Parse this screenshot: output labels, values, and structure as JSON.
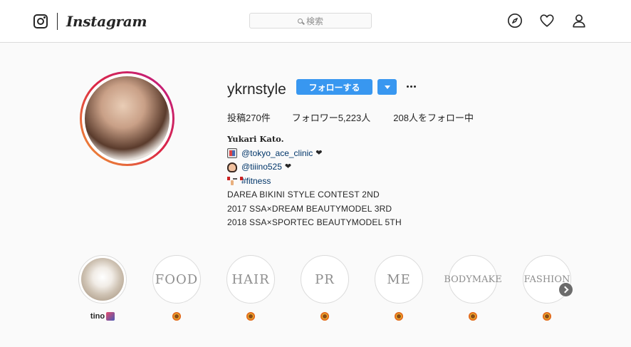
{
  "nav": {
    "logo_text": "Instagram",
    "search_placeholder": "検索",
    "icons": [
      "camera-icon",
      "explore-compass-icon",
      "heart-icon",
      "profile-icon"
    ]
  },
  "profile": {
    "username": "ykrnstyle",
    "follow_label": "フォローする",
    "stats": {
      "posts": "投稿270件",
      "followers": "フォロワー5,223人",
      "following": "208人をフォロー中"
    },
    "bio": {
      "name": "Yukari Kato.",
      "lines": [
        {
          "emoji": "clinic-icon",
          "text": "@tokyo_ace_clinic",
          "suffix": "❤"
        },
        {
          "emoji": "face-icon",
          "text": "@tiiino525",
          "suffix": "❤"
        },
        {
          "emoji": "dumbbell-icon",
          "text": "#fitness",
          "suffix": ""
        }
      ],
      "contest_lines": [
        "DAREA BIKINI STYLE CONTEST 2ND",
        "2017 SSA×DREAM BEAUTYMODEL 3RD",
        "2018 SSA×SPORTEC BEAUTYMODEL 5TH"
      ]
    }
  },
  "highlights": [
    {
      "title": "",
      "label": "tino",
      "type": "photo"
    },
    {
      "title": "FOOD",
      "label": "",
      "type": "text"
    },
    {
      "title": "HAIR",
      "label": "",
      "type": "text"
    },
    {
      "title": "PR",
      "label": "",
      "type": "text"
    },
    {
      "title": "ME",
      "label": "",
      "type": "text"
    },
    {
      "title": "BODYMAKE",
      "label": "",
      "type": "text"
    },
    {
      "title": "FASHION",
      "label": "",
      "type": "text"
    }
  ],
  "colors": {
    "accent": "#3897f0",
    "link": "#003569",
    "border": "#dbdbdb",
    "background": "#fafafa"
  }
}
